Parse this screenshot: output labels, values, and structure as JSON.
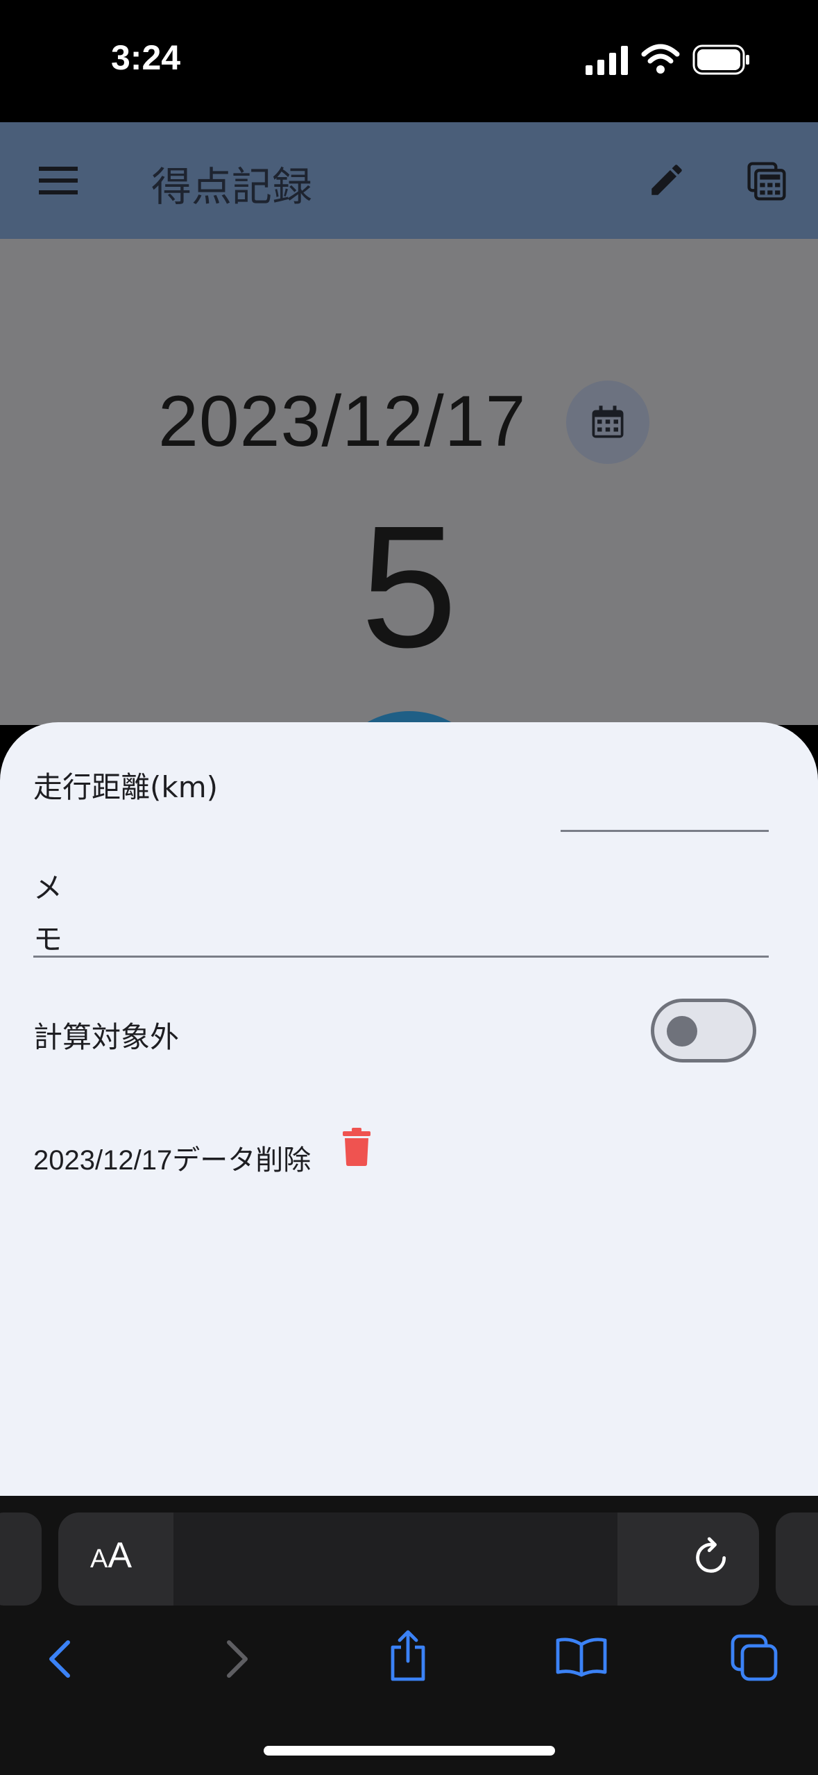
{
  "status_bar": {
    "time": "3:24"
  },
  "app_bar": {
    "title": "得点記録"
  },
  "main": {
    "date": "2023/12/17",
    "score": "5"
  },
  "sheet": {
    "distance_label": "走行距離(km)",
    "distance_value": "",
    "memo_label": "メモ",
    "memo_value": "",
    "exclude_label": "計算対象外",
    "exclude_on": false,
    "delete_label": "2023/12/17データ削除"
  },
  "browser": {
    "text_size_label_small": "A",
    "text_size_label_big": "A",
    "url": ""
  },
  "colors": {
    "app_bar": "#4a5e79",
    "sheet": "#eff2f9",
    "trash": "#ef5350",
    "browser_accent": "#3b82f6"
  },
  "icons": [
    "menu-icon",
    "pencil-icon",
    "calculator-icon",
    "calendar-icon",
    "trash-icon",
    "reload-icon",
    "back-icon",
    "forward-icon",
    "share-icon",
    "bookmarks-icon",
    "tabs-icon"
  ]
}
